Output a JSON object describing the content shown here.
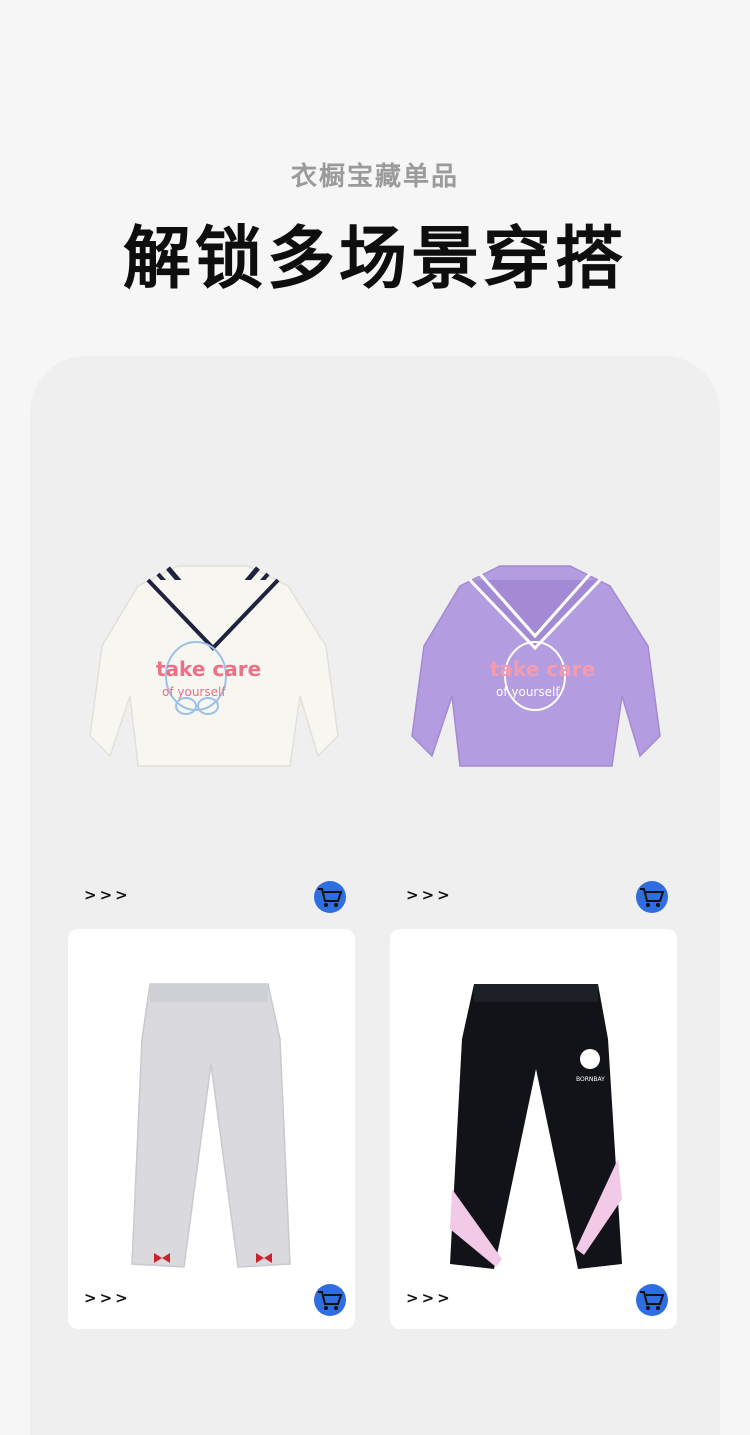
{
  "header": {
    "subtitle": "衣橱宝藏单品",
    "title": "解锁多场景穿搭"
  },
  "products": [
    {
      "item": "white-sailor-sweatshirt",
      "more_label": ">>>",
      "print": [
        "take care",
        "of yourself"
      ],
      "cart_icon": "cart-icon",
      "colors": {
        "body": "#f7f6f1",
        "collar": "#1f2340"
      }
    },
    {
      "item": "purple-sailor-sweatshirt",
      "more_label": ">>>",
      "print": [
        "take care",
        "of yourself"
      ],
      "cart_icon": "cart-icon",
      "colors": {
        "body": "#b49ce0",
        "collar": "#9f84d6"
      }
    },
    {
      "item": "grey-flare-pants",
      "more_label": ">>>",
      "cart_icon": "cart-icon",
      "colors": {
        "body": "#d9d9de",
        "bow": "#c8242f"
      }
    },
    {
      "item": "black-jogger-pants",
      "more_label": ">>>",
      "label": "BORNBAY",
      "cart_icon": "cart-icon",
      "colors": {
        "body": "#111318",
        "stripe": "#f2c9e6"
      }
    }
  ],
  "colors": {
    "accent": "#2f6ee0",
    "panel": "#efefef",
    "background": "#f6f6f6"
  }
}
